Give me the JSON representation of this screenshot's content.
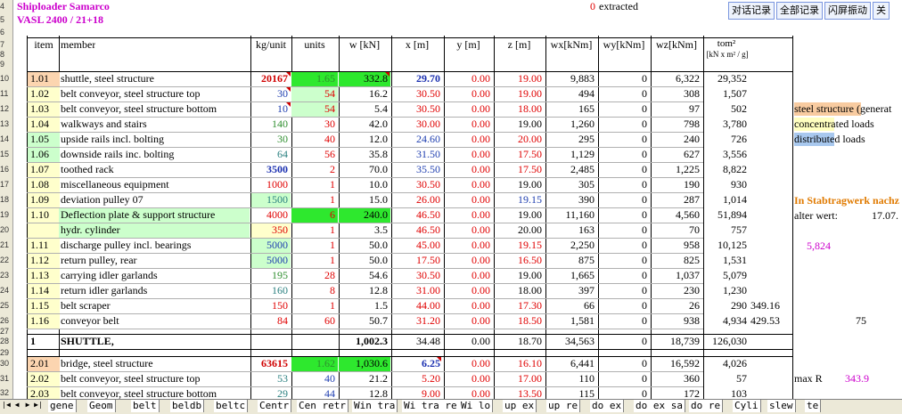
{
  "header": {
    "title1": "Shiploader  Samarco",
    "title2": "VASL 2400 / 21+18",
    "extracted_value": "0",
    "extracted_label": "extracted"
  },
  "toolbar": {
    "buttons": [
      "对话记录",
      "全部记录",
      "闪屏振动",
      "关"
    ]
  },
  "row_numbers": [
    "4",
    "5",
    "6",
    "7",
    "8",
    "9",
    "10",
    "11",
    "12",
    "13",
    "14",
    "15",
    "16",
    "17",
    "18",
    "19",
    "20",
    "21",
    "22",
    "23",
    "24",
    "25",
    "26",
    "27",
    "28",
    "29",
    "30",
    "31",
    "32"
  ],
  "columns": {
    "item": "item",
    "member": "member",
    "kgunit": "kg/unit",
    "units": "units",
    "w": "w [kN]",
    "x": "x [m]",
    "y": "y [m]",
    "z": "z [m]",
    "wx": "wx[kNm]",
    "wy": "wy[kNm]",
    "wz": "wz[kNm]",
    "tom": "tom²",
    "tom_unit": "[kN x m² / g]"
  },
  "rows": [
    {
      "item": "1.01",
      "member": "shuttle, steel structure",
      "kg": "20167",
      "units": "1.65",
      "w": "332.8",
      "x": "29.70",
      "y": "0.00",
      "z": "19.00",
      "wx": "9,883",
      "wy": "0",
      "wz": "6,322",
      "tom": "29,352",
      "extra": ""
    },
    {
      "item": "1.02",
      "member": "belt conveyor, steel structure top",
      "kg": "30",
      "units": "54",
      "w": "16.2",
      "x": "30.50",
      "y": "0.00",
      "z": "19.00",
      "wx": "494",
      "wy": "0",
      "wz": "308",
      "tom": "1,507",
      "extra": ""
    },
    {
      "item": "1.03",
      "member": "belt conveyor, steel structure bottom",
      "kg": "10",
      "units": "54",
      "w": "5.4",
      "x": "30.50",
      "y": "0.00",
      "z": "18.00",
      "wx": "165",
      "wy": "0",
      "wz": "97",
      "tom": "502",
      "extra": ""
    },
    {
      "item": "1.04",
      "member": "walkways and stairs",
      "kg": "140",
      "units": "30",
      "w": "42.0",
      "x": "30.00",
      "y": "0.00",
      "z": "19.00",
      "wx": "1,260",
      "wy": "0",
      "wz": "798",
      "tom": "3,780",
      "extra": ""
    },
    {
      "item": "1.05",
      "member": "upside rails incl. bolting",
      "kg": "30",
      "units": "40",
      "w": "12.0",
      "x": "24.60",
      "y": "0.00",
      "z": "20.00",
      "wx": "295",
      "wy": "0",
      "wz": "240",
      "tom": "726",
      "extra": ""
    },
    {
      "item": "1.06",
      "member": "downside rails inc. bolting",
      "kg": "64",
      "units": "56",
      "w": "35.8",
      "x": "31.50",
      "y": "0.00",
      "z": "17.50",
      "wx": "1,129",
      "wy": "0",
      "wz": "627",
      "tom": "3,556",
      "extra": ""
    },
    {
      "item": "1.07",
      "member": "toothed rack",
      "kg": "3500",
      "units": "2",
      "w": "70.0",
      "x": "35.50",
      "y": "0.00",
      "z": "17.50",
      "wx": "2,485",
      "wy": "0",
      "wz": "1,225",
      "tom": "8,822",
      "extra": ""
    },
    {
      "item": "1.08",
      "member": "miscellaneous equipment",
      "kg": "1000",
      "units": "1",
      "w": "10.0",
      "x": "30.50",
      "y": "0.00",
      "z": "19.00",
      "wx": "305",
      "wy": "0",
      "wz": "190",
      "tom": "930",
      "extra": ""
    },
    {
      "item": "1.09",
      "member": "deviation pulley 07",
      "kg": "1500",
      "units": "1",
      "w": "15.0",
      "x": "26.00",
      "y": "0.00",
      "z": "19.15",
      "wx": "390",
      "wy": "0",
      "wz": "287",
      "tom": "1,014",
      "extra": ""
    },
    {
      "item": "1.10",
      "member": "Deflection plate & support structure",
      "kg": "4000",
      "units": "6",
      "w": "240.0",
      "x": "46.50",
      "y": "0.00",
      "z": "19.00",
      "wx": "11,160",
      "wy": "0",
      "wz": "4,560",
      "tom": "51,894",
      "extra": ""
    },
    {
      "item": "",
      "member": "hydr. cylinder",
      "kg": "350",
      "units": "1",
      "w": "3.5",
      "x": "46.50",
      "y": "0.00",
      "z": "20.00",
      "wx": "163",
      "wy": "0",
      "wz": "70",
      "tom": "757",
      "extra": ""
    },
    {
      "item": "1.11",
      "member": "discharge pulley incl. bearings",
      "kg": "5000",
      "units": "1",
      "w": "50.0",
      "x": "45.00",
      "y": "0.00",
      "z": "19.15",
      "wx": "2,250",
      "wy": "0",
      "wz": "958",
      "tom": "10,125",
      "extra": ""
    },
    {
      "item": "1.12",
      "member": "return pulley, rear",
      "kg": "5000",
      "units": "1",
      "w": "50.0",
      "x": "17.50",
      "y": "0.00",
      "z": "16.50",
      "wx": "875",
      "wy": "0",
      "wz": "825",
      "tom": "1,531",
      "extra": ""
    },
    {
      "item": "1.13",
      "member": "carrying idler garlands",
      "kg": "195",
      "units": "28",
      "w": "54.6",
      "x": "30.50",
      "y": "0.00",
      "z": "19.00",
      "wx": "1,665",
      "wy": "0",
      "wz": "1,037",
      "tom": "5,079",
      "extra": ""
    },
    {
      "item": "1.14",
      "member": "return idler garlands",
      "kg": "160",
      "units": "8",
      "w": "12.8",
      "x": "31.00",
      "y": "0.00",
      "z": "18.00",
      "wx": "397",
      "wy": "0",
      "wz": "230",
      "tom": "1,230",
      "extra": ""
    },
    {
      "item": "1.15",
      "member": "belt scraper",
      "kg": "150",
      "units": "1",
      "w": "1.5",
      "x": "44.00",
      "y": "0.00",
      "z": "17.30",
      "wx": "66",
      "wy": "0",
      "wz": "26",
      "tom": "290",
      "extra": "349.16"
    },
    {
      "item": "1.16",
      "member": "conveyor belt",
      "kg": "84",
      "units": "60",
      "w": "50.7",
      "x": "31.20",
      "y": "0.00",
      "z": "18.50",
      "wx": "1,581",
      "wy": "0",
      "wz": "938",
      "tom": "4,934",
      "extra": "429.53"
    }
  ],
  "total": {
    "item": "1",
    "member": "SHUTTLE,",
    "w": "1,002.3",
    "x": "34.48",
    "y": "0.00",
    "z": "18.70",
    "wx": "34,563",
    "wy": "0",
    "wz": "18,739",
    "tom": "126,030"
  },
  "rows2": [
    {
      "item": "2.01",
      "member": "bridge, steel structure",
      "kg": "63615",
      "units": "1.62",
      "w": "1,030.6",
      "x": "6.25",
      "y": "0.00",
      "z": "16.10",
      "wx": "6,441",
      "wy": "0",
      "wz": "16,592",
      "tom": "4,026"
    },
    {
      "item": "2.02",
      "member": "belt conveyor, steel structure top",
      "kg": "53",
      "units": "40",
      "w": "21.2",
      "x": "5.20",
      "y": "0.00",
      "z": "17.00",
      "wx": "110",
      "wy": "0",
      "wz": "360",
      "tom": "57"
    },
    {
      "item": "2.03",
      "member": "belt conveyor, steel structure bottom",
      "kg": "29",
      "units": "44",
      "w": "12.8",
      "x": "9.00",
      "y": "0.00",
      "z": "13.50",
      "wx": "115",
      "wy": "0",
      "wz": "172",
      "tom": "103"
    }
  ],
  "side": {
    "legend1": "steel structure (generat",
    "legend2": "concentrated loads",
    "legend3": "distributed loads",
    "stab": "In Stabtragwerk nachz",
    "alter_label": "alter wert:",
    "alter_value": "17.07.",
    "val_5824": "5,824",
    "val_75": "75",
    "maxr_label": "max R",
    "maxr_value": "343.9"
  },
  "tabs": [
    "gene",
    "Geom",
    "belt",
    "beldb",
    "beltc",
    "Centr",
    "Cen retr",
    "Win tra",
    "Wi tra re",
    "Wi  lo",
    "up ex",
    "up re",
    "do ex",
    "do ex sa",
    "do re",
    "Cyli",
    "slew",
    "te"
  ],
  "colors": {
    "legend_orange": "#f8cba0",
    "legend_yellow": "#ffffc0",
    "legend_blue": "#a8c8ee",
    "highlight_green": "#2ee82e",
    "light_green": "#ccffcc",
    "item_orange": "#fcd5b0",
    "item_yellow": "#ffffcc"
  }
}
